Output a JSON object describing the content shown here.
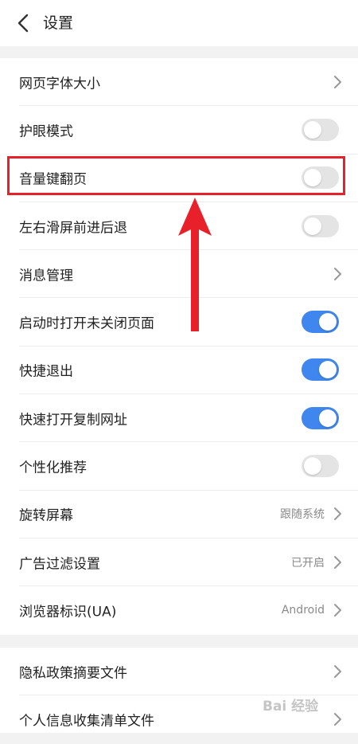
{
  "header": {
    "title": "设置"
  },
  "settings_group_1": [
    {
      "label": "网页字体大小",
      "type": "chevron"
    },
    {
      "label": "护眼模式",
      "type": "toggle",
      "on": false
    },
    {
      "label": "音量键翻页",
      "type": "toggle",
      "on": false
    },
    {
      "label": "左右滑屏前进后退",
      "type": "toggle",
      "on": false
    },
    {
      "label": "消息管理",
      "type": "chevron"
    },
    {
      "label": "启动时打开未关闭页面",
      "type": "toggle",
      "on": true
    },
    {
      "label": "快捷退出",
      "type": "toggle",
      "on": true
    },
    {
      "label": "快速打开复制网址",
      "type": "toggle",
      "on": true
    },
    {
      "label": "个性化推荐",
      "type": "toggle",
      "on": false
    },
    {
      "label": "旋转屏幕",
      "type": "chevron",
      "value": "跟随系统"
    },
    {
      "label": "广告过滤设置",
      "type": "chevron",
      "value": "已开启"
    },
    {
      "label": "浏览器标识(UA)",
      "type": "chevron",
      "value": "Android"
    }
  ],
  "settings_group_2": [
    {
      "label": "隐私政策摘要文件",
      "type": "chevron"
    },
    {
      "label": "个人信息收集清单文件",
      "type": "chevron"
    }
  ],
  "watermark": "Bai 经验",
  "colors": {
    "toggle_on": "#3f86ee",
    "toggle_off": "#e4e4e4",
    "highlight": "#e8202a",
    "arrow": "#e8202a"
  },
  "icons": {
    "back": "chevron-left-icon",
    "row_arrow": "chevron-right-icon",
    "annotation": "arrow-up-icon"
  }
}
